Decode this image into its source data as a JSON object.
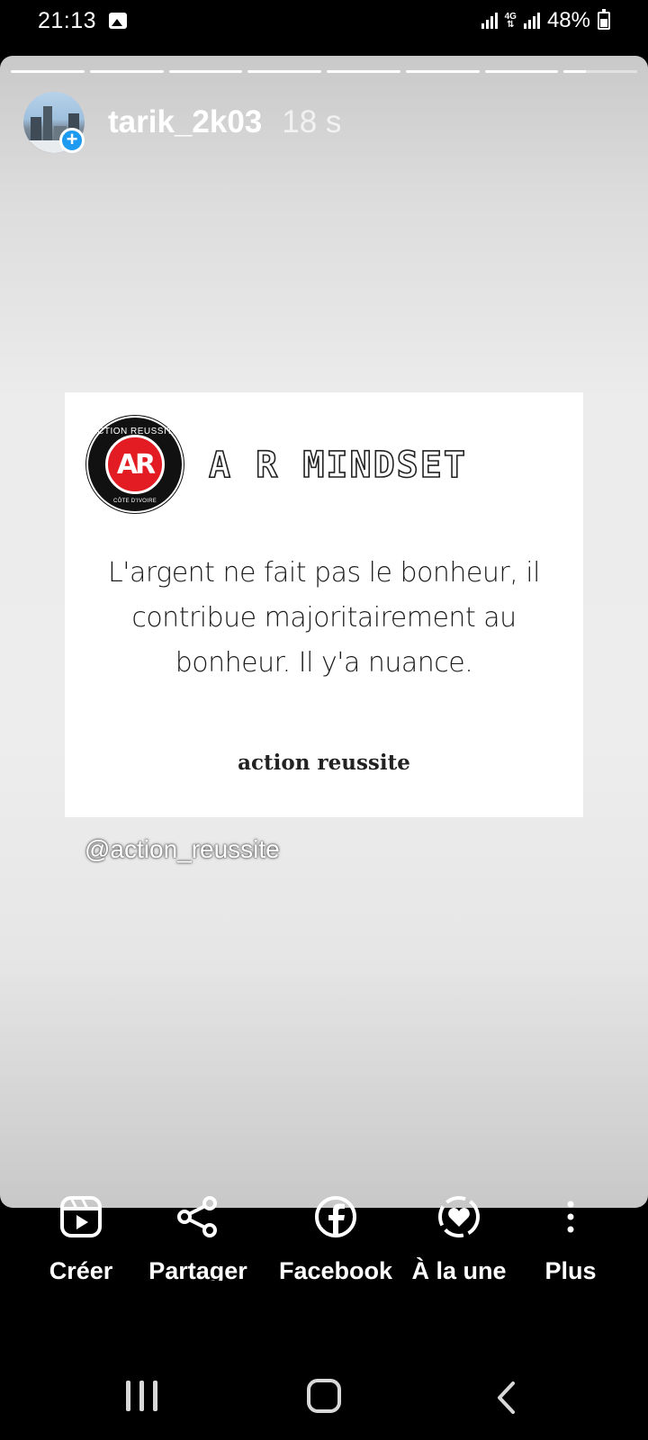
{
  "status_bar": {
    "time": "21:13",
    "network": "4G",
    "battery": "48%",
    "icons": [
      "gallery-icon",
      "signal-icon",
      "4g-icon",
      "signal-icon",
      "battery-icon"
    ]
  },
  "story": {
    "progress": {
      "total_segments": 8,
      "completed_segments": 7,
      "current_fraction": 0.3
    },
    "username": "tarik_2k03",
    "time_ago": "18 s",
    "post": {
      "logo_text_top": "ACTION REUSSITE",
      "logo_monogram": "AR",
      "logo_text_bottom": "CÔTE D'IVOIRE",
      "title": "A R MINDSET",
      "quote_lines": [
        "L'argent ne fait pas le bonheur, il",
        "contribue majoritairement au",
        "bonheur. Il y'a nuance."
      ],
      "signature": "action reussite"
    },
    "mention": "@action_reussite"
  },
  "actions": [
    {
      "label": "Créer",
      "icon": "reels-icon"
    },
    {
      "label": "Partager",
      "icon": "share-icon"
    },
    {
      "label": "Facebook",
      "icon": "facebook-icon"
    },
    {
      "label": "À la une",
      "icon": "highlight-icon"
    },
    {
      "label": "Plus",
      "icon": "more-icon"
    }
  ],
  "navigation": [
    "recent-apps-icon",
    "home-icon",
    "back-icon"
  ],
  "colors": {
    "accent_blue": "#1d9bf0",
    "logo_red": "#e31b23"
  }
}
